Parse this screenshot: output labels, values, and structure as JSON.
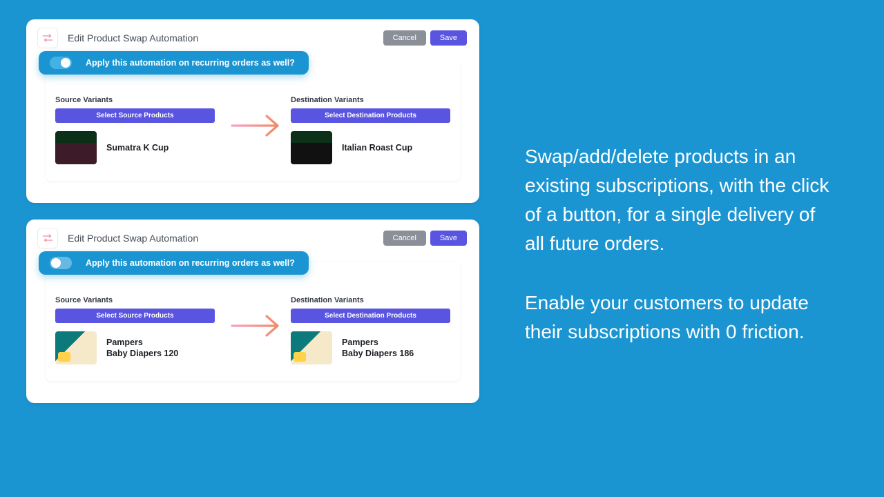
{
  "right": {
    "para1": "Swap/add/delete products in an existing subscriptions, with the click of a button, for a single delivery of all future orders.",
    "para2": "Enable your customers to update their subscriptions with 0 friction."
  },
  "cards": [
    {
      "title": "Edit Product Swap Automation",
      "cancel": "Cancel",
      "save": "Save",
      "toggleOn": true,
      "toggleLabel": "Apply this automation on recurring orders as well?",
      "source": {
        "label": "Source Variants",
        "button": "Select Source Products",
        "productName": "Sumatra K Cup",
        "imgClass": "coffee-dark"
      },
      "dest": {
        "label": "Destination Variants",
        "button": "Select Destination Products",
        "productName": "Italian Roast Cup",
        "imgClass": "coffee-black"
      }
    },
    {
      "title": "Edit Product Swap Automation",
      "cancel": "Cancel",
      "save": "Save",
      "toggleOn": false,
      "toggleLabel": "Apply this automation on recurring orders as well?",
      "source": {
        "label": "Source Variants",
        "button": "Select Source Products",
        "productName": "Pampers\nBaby Diapers 120",
        "imgClass": "pampers"
      },
      "dest": {
        "label": "Destination Variants",
        "button": "Select Destination Products",
        "productName": "Pampers\nBaby Diapers 186",
        "imgClass": "pampers"
      }
    }
  ]
}
